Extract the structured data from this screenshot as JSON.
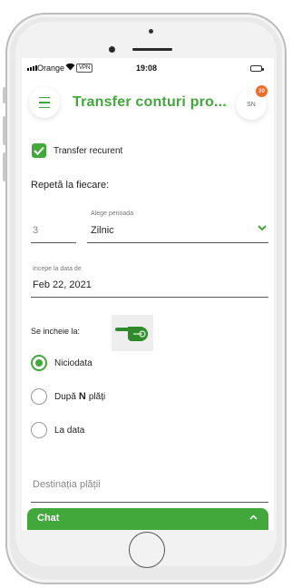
{
  "colors": {
    "accent": "#43a83c",
    "badge": "#ef6b2a"
  },
  "status_bar": {
    "carrier": "Orange",
    "vpn": "VPN",
    "time": "19:08"
  },
  "header": {
    "title": "Transfer conturi pro...",
    "avatar_initials": "SN",
    "badge_count": "20"
  },
  "recurring": {
    "checkbox_label": "Transfer recurent",
    "checked": true
  },
  "repeat": {
    "label": "Repetă la fiecare:",
    "count_value": "3",
    "period_label": "Alege perioada",
    "period_value": "Zilnic"
  },
  "start_date": {
    "label": "Incepe la data de",
    "value": "Feb 22, 2021"
  },
  "ends": {
    "label": "Se incheie la:",
    "options": [
      {
        "label": "Niciodata",
        "selected": true
      },
      {
        "label_before": "După",
        "label_highlight": "N",
        "label_after": "plăți",
        "selected": false
      },
      {
        "label": "La data",
        "selected": false
      }
    ]
  },
  "destination": {
    "placeholder": "Destinația plății"
  },
  "chat": {
    "label": "Chat"
  },
  "icons": [
    "menu-icon",
    "check-icon",
    "chevron-down-icon",
    "pointing-hand-icon",
    "chevron-up-icon",
    "wifi-icon",
    "signal-icon",
    "battery-icon"
  ]
}
